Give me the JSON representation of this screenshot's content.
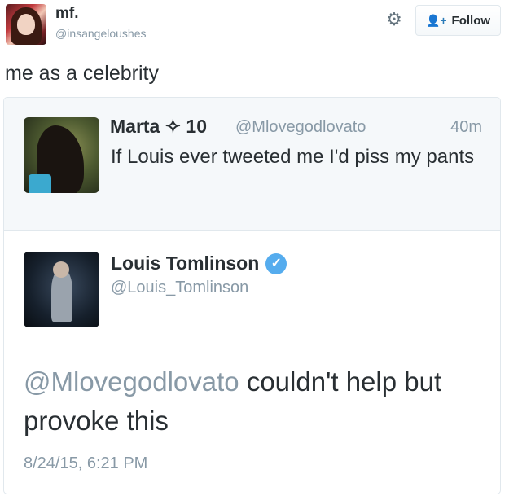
{
  "tweet": {
    "author_name": "mf.",
    "author_handle": "@insangeloushes",
    "text": "me as a celebrity",
    "follow_label": "Follow",
    "icons": {
      "settings": "gear-icon",
      "follow": "add-person-icon"
    }
  },
  "quoted_tweet": {
    "name": "Marta",
    "badge_icon": "sparkle-icon",
    "badge_text": "10",
    "handle": "@Mlovegodlovato",
    "time": "40m",
    "text": "If Louis ever tweeted me I'd piss my pants"
  },
  "embedded_tweet": {
    "name": "Louis Tomlinson",
    "verified_icon": "verified-icon",
    "handle": "@Louis_Tomlinson",
    "mention": "@Mlovegodlovato",
    "text": "couldn't help but provoke this",
    "date": "8/24/15, 6:21 PM"
  },
  "colors": {
    "link": "#55acee",
    "secondary_text": "#8899a6",
    "primary_text": "#292f33"
  }
}
